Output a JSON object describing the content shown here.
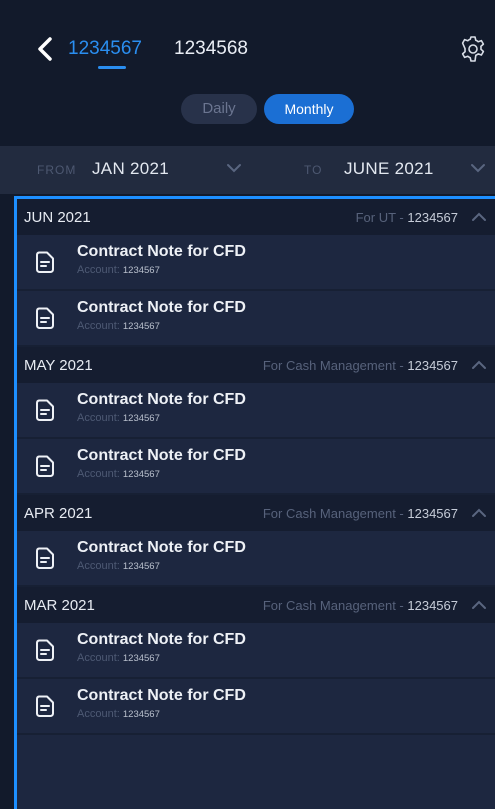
{
  "header": {
    "tabs": [
      {
        "label": "1234567",
        "active": true
      },
      {
        "label": "1234568",
        "active": false
      }
    ]
  },
  "toggle": {
    "daily_label": "Daily",
    "monthly_label": "Monthly",
    "selected": "Monthly"
  },
  "filter": {
    "from_label": "FROM",
    "from_value": "JAN 2021",
    "to_label": "TO",
    "to_value": "JUNE 2021"
  },
  "colors": {
    "accent": "#1d8fff",
    "background": "#121a2b",
    "row": "#1d2740"
  },
  "sections": [
    {
      "month": "JUN 2021",
      "sub": "For UT - ",
      "account": "1234567",
      "items": [
        {
          "title": "Contract Note for CFD",
          "account_label": "Account:",
          "account": "1234567"
        },
        {
          "title": "Contract Note for CFD",
          "account_label": "Account:",
          "account": "1234567"
        }
      ]
    },
    {
      "month": "MAY 2021",
      "sub": "For Cash Management - ",
      "account": "1234567",
      "items": [
        {
          "title": "Contract Note for CFD",
          "account_label": "Account:",
          "account": "1234567"
        },
        {
          "title": "Contract Note for CFD",
          "account_label": "Account:",
          "account": "1234567"
        }
      ]
    },
    {
      "month": "APR 2021",
      "sub": "For Cash Management - ",
      "account": "1234567",
      "items": [
        {
          "title": "Contract Note for CFD",
          "account_label": "Account:",
          "account": "1234567"
        }
      ]
    },
    {
      "month": "MAR 2021",
      "sub": "For Cash Management - ",
      "account": "1234567",
      "items": [
        {
          "title": "Contract Note for CFD",
          "account_label": "Account:",
          "account": "1234567"
        },
        {
          "title": "Contract Note for CFD",
          "account_label": "Account:",
          "account": "1234567"
        }
      ]
    }
  ]
}
